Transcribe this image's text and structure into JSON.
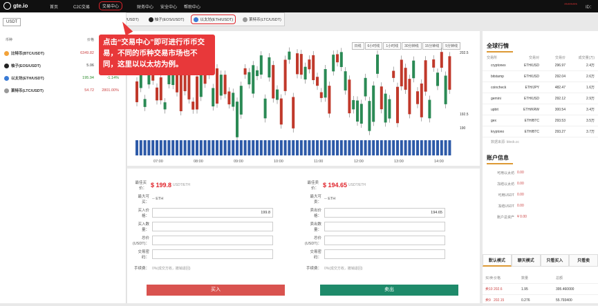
{
  "topbar": {
    "logo": "gte.io",
    "nav": [
      "首页",
      "C2C交易",
      "交易中心",
      "财务中心",
      "安全中心",
      "帮助中心"
    ],
    "user_name": "********",
    "uid_label": "ID："
  },
  "dropdown": [
    {
      "label": "比特币(BTC/USDT)",
      "color": "#f2a33a"
    },
    {
      "label": "柚子(EOS/USDT)",
      "color": "#222222"
    },
    {
      "label": "以太坊(ETH/USDT)",
      "color": "#3a7bd5"
    },
    {
      "label": "莱特币(LTC/USDT)",
      "color": "#999999"
    }
  ],
  "left": {
    "tab": "USDT",
    "headers": [
      "币种",
      "价格",
      "日"
    ],
    "rows": [
      {
        "name": "比特币(BTC/USDT)",
        "price": "6349.82",
        "change": "",
        "color": "#f2a33a"
      },
      {
        "name": "柚子(EOS/USDT)",
        "price": "5.06",
        "change": "",
        "color": "#222222"
      },
      {
        "name": "以太坊(ETH/USDT)",
        "price": "195.94",
        "change": "-1.14%",
        "color": "#3a7bd5"
      },
      {
        "name": "莱特币(LTC/USDT)",
        "price": "54.72",
        "change": "2801.00%",
        "color": "#999999"
      }
    ]
  },
  "chart": {
    "timeframes": [
      "日线",
      "6小时线",
      "1小时线",
      "30分钟线",
      "15分钟线",
      "5分钟线"
    ],
    "price_labels": [
      "202.5",
      "192.5",
      "190"
    ],
    "x_labels": [
      "07:00",
      "08:00",
      "09:00",
      "10:00",
      "11:00",
      "12:00",
      "13:00",
      "14:00"
    ]
  },
  "chart_data": {
    "type": "bar",
    "title": "",
    "categories": [
      "07:00",
      "08:00",
      "09:00",
      "10:00",
      "11:00",
      "12:00",
      "13:00",
      "14:00"
    ],
    "ylim": [
      190,
      202.5
    ]
  },
  "trade": {
    "buy": {
      "best_label": "最佳买价：",
      "best_price": "$ 199.8",
      "unit": "USDT/ETH",
      "max_label": "最大可买：",
      "max_value": "-- ETH",
      "price_label": "买入价格：",
      "price_value": "199.8",
      "qty_label": "买入数量：",
      "total_label": "总价(USDT)：",
      "pwd_label": "交易密码：",
      "fee_label": "手续费：",
      "fee_text": "0%(成交方收，撤销退回)",
      "button": "买入"
    },
    "sell": {
      "best_label": "最佳卖价：",
      "best_price": "$ 194.65",
      "unit": "USDT/ETH",
      "max_label": "最大可卖：",
      "max_value": "-- ETH",
      "price_label": "卖出价格：",
      "price_value": "194.65",
      "qty_label": "卖出数量：",
      "total_label": "总价(USDT)：",
      "pwd_label": "交易密码：",
      "fee_label": "手续费：",
      "fee_text": "0%(成交方收，撤销退回)",
      "button": "卖出"
    }
  },
  "market": {
    "title": "全球行情",
    "headers": [
      "交易所",
      "交易对",
      "交易价",
      "成交量(万)"
    ],
    "rows": [
      [
        "cryptonex",
        "ETH/USD",
        "296.97",
        "2.4万"
      ],
      [
        "bitstamp",
        "ETH/USD",
        "292.04",
        "2.6万"
      ],
      [
        "coincheck",
        "ETH/JPY",
        "482.47",
        "1.6万"
      ],
      [
        "gemini",
        "ETH/USD",
        "292.12",
        "2.9万"
      ],
      [
        "upbit",
        "ETH/KRW",
        "300.54",
        "3.4万"
      ],
      [
        "gex",
        "ETH/BTC",
        "293.53",
        "3.5万"
      ],
      [
        "kryptono",
        "ETH/BTC",
        "293.27",
        "3.7万"
      ]
    ],
    "source": "数据来源: block.cc"
  },
  "account": {
    "title": "账户信息",
    "rows": [
      {
        "k": "可用以太坊",
        "v": "0.00"
      },
      {
        "k": "冻结以太坊",
        "v": "0.00"
      },
      {
        "k": "可用USDT",
        "v": "0.00"
      },
      {
        "k": "冻结USDT",
        "v": "0.00"
      },
      {
        "k": "账户总资产",
        "v": "¥ 0.00"
      }
    ]
  },
  "bottom_tabs": [
    "默认模式",
    "聊天模式",
    "只看买入",
    "只看卖"
  ],
  "orders": {
    "headers": [
      "买/卖",
      "价格",
      "数量",
      "总额"
    ],
    "rows": [
      [
        "卖10",
        "202.6",
        "1.95",
        "395.460000"
      ],
      [
        "卖9",
        "202.15",
        "0.276",
        "55.793400"
      ]
    ]
  },
  "callout": {
    "text": "点击“交易中心”即可进行币币交易，不同的币种交易市场也不同，这里以以太坊为例。"
  }
}
